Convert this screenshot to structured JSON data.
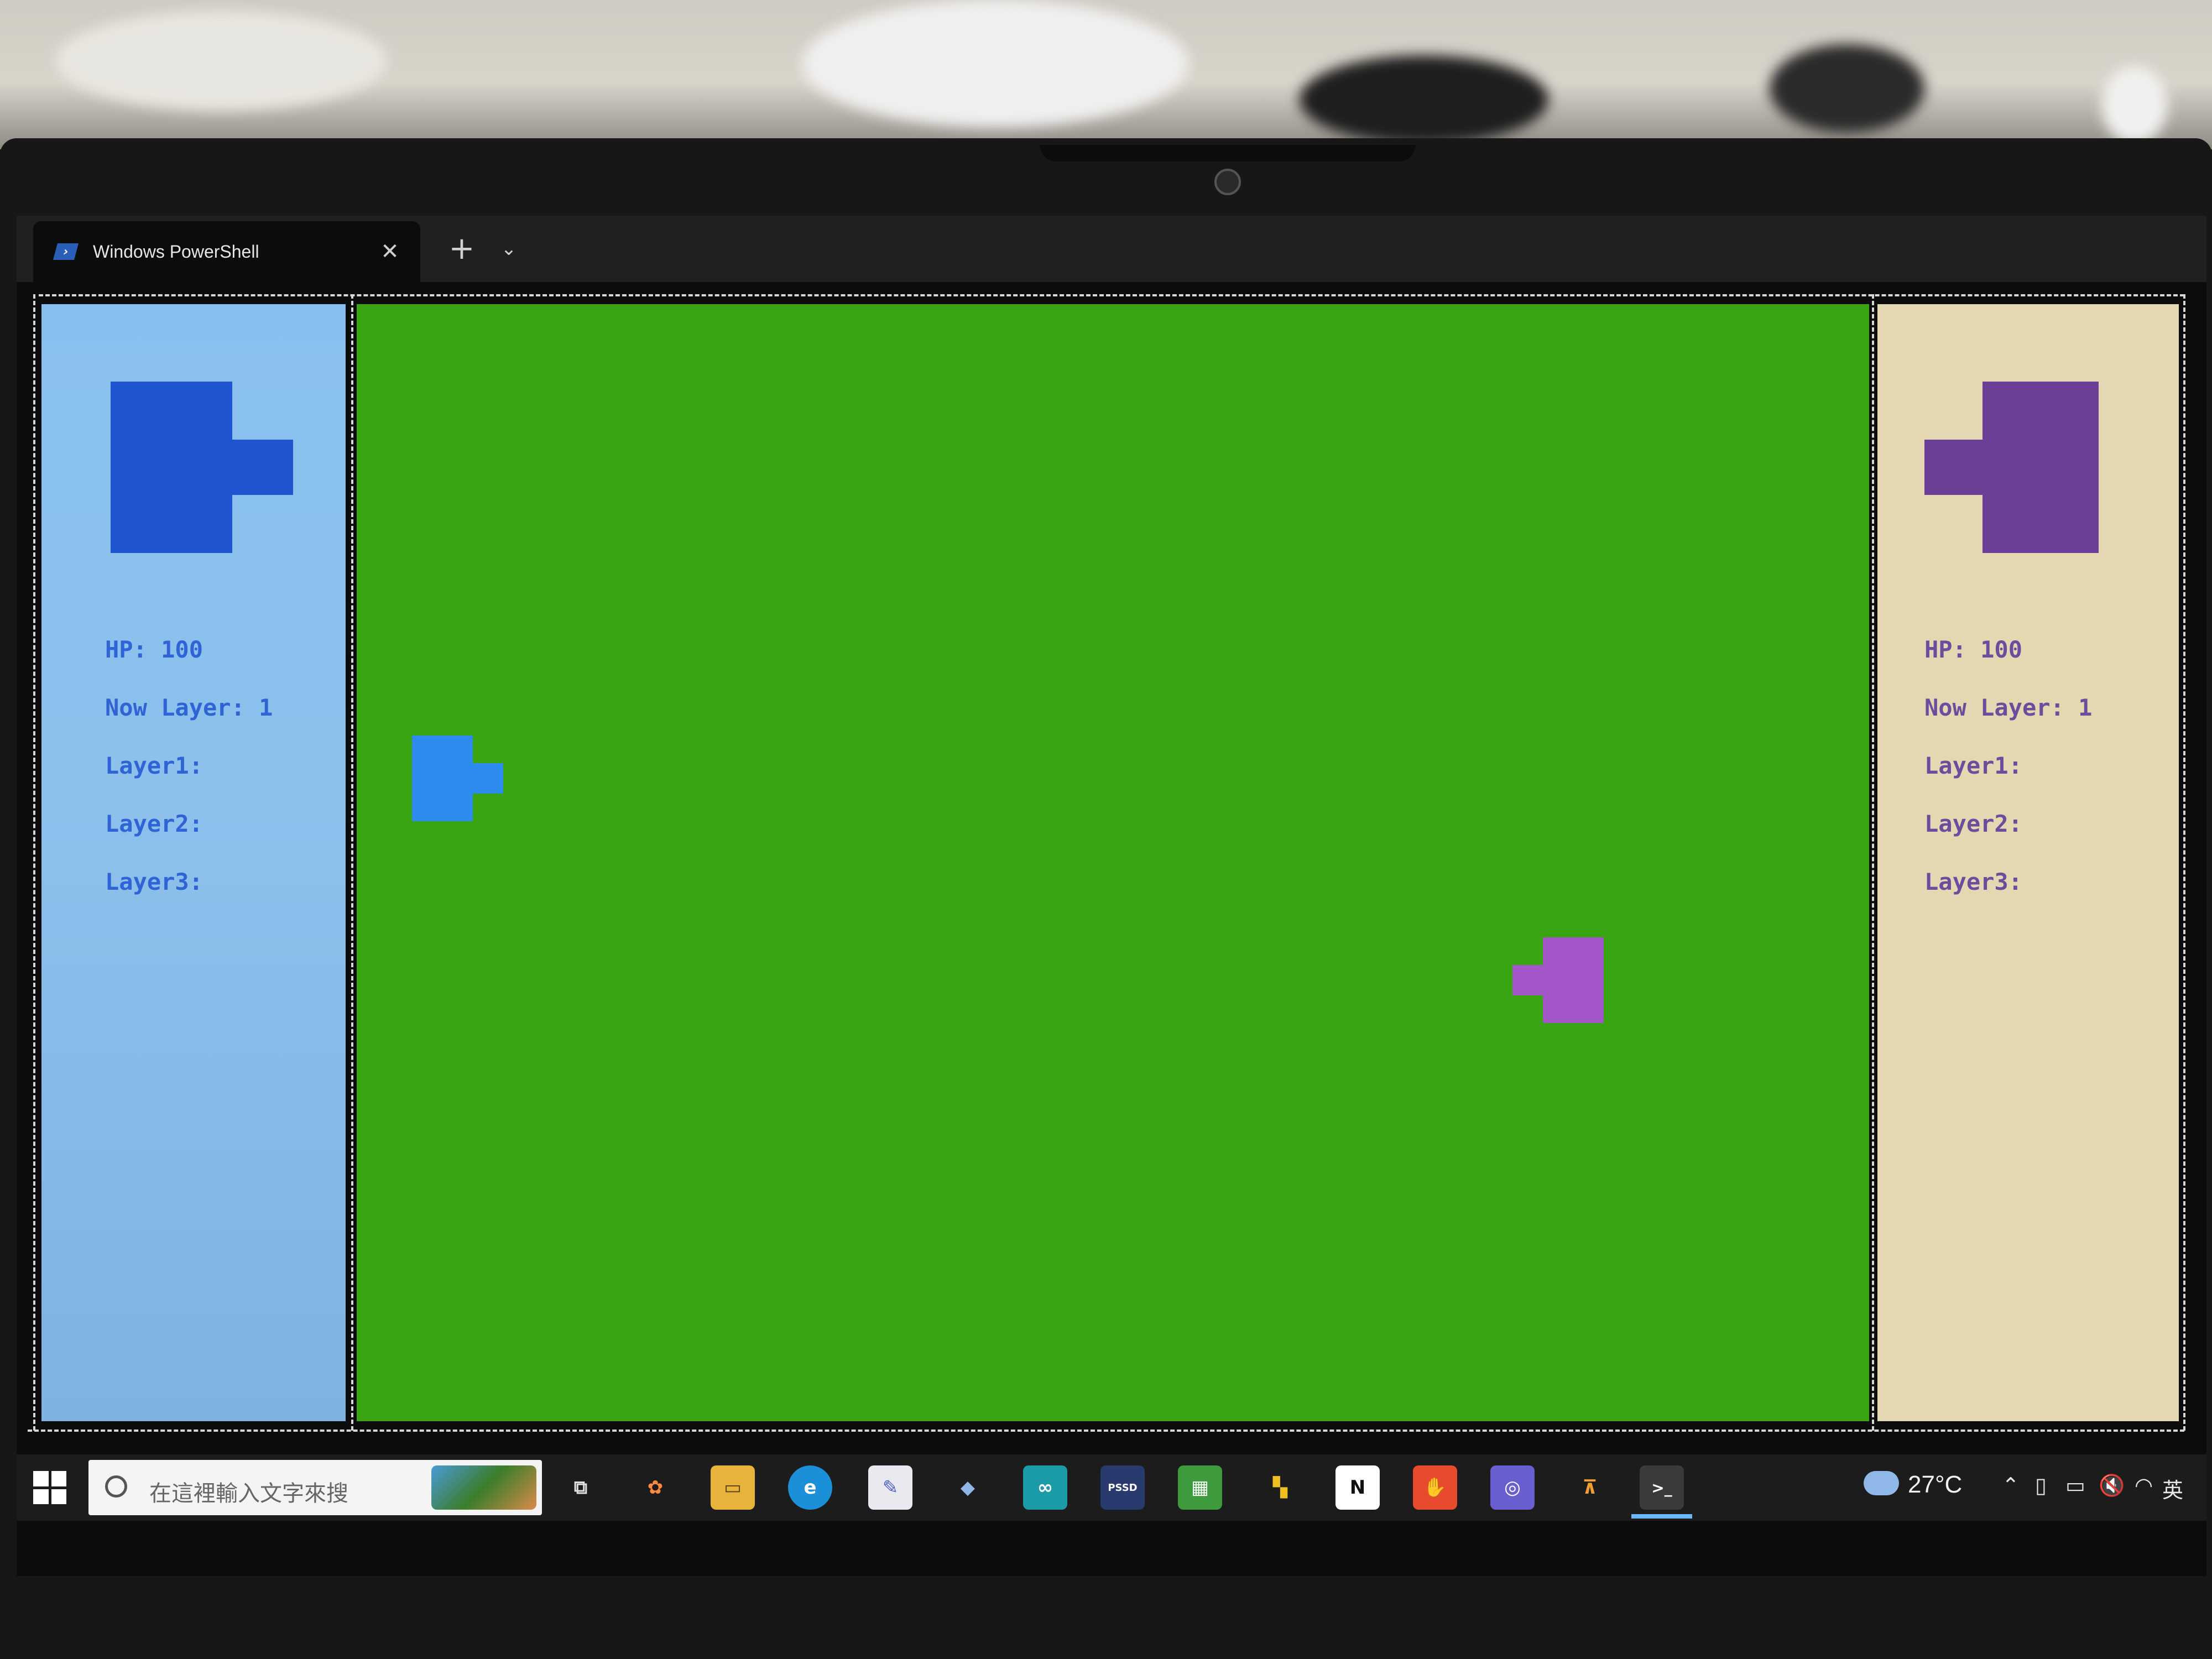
{
  "window": {
    "tab_title": "Windows PowerShell",
    "tab_icon_glyph": "›",
    "close_glyph": "✕",
    "new_tab_glyph": "+",
    "dropdown_glyph": "⌄"
  },
  "player_left": {
    "color": "#1f55d0",
    "text_color": "#2f63d6",
    "panel_color": "#8dc1ec",
    "hp_text": "HP: 100",
    "layer_text": "Now Layer: 1",
    "layers": [
      "Layer1:",
      "Layer2:",
      "Layer3:"
    ]
  },
  "player_right": {
    "color": "#6b3f96",
    "text_color": "#6a4d9c",
    "panel_color": "#e4d8b3",
    "hp_text": "HP: 100",
    "layer_text": "Now Layer: 1",
    "layers": [
      "Layer1:",
      "Layer2:",
      "Layer3:"
    ]
  },
  "game_field": {
    "background": "#3aa512",
    "tank_left_color": "#2e8cf0",
    "tank_right_color": "#a356c8"
  },
  "taskbar": {
    "search_placeholder": "在這裡輸入文字來搜",
    "weather_temp": "27°C",
    "language": "英",
    "apps": [
      {
        "name": "task-view-icon",
        "glyph": "⧉"
      },
      {
        "name": "copilot-icon",
        "glyph": "✿"
      },
      {
        "name": "file-explorer-icon",
        "glyph": "▭"
      },
      {
        "name": "edge-icon",
        "glyph": "e"
      },
      {
        "name": "paint-icon",
        "glyph": "✎"
      },
      {
        "name": "notepad-icon",
        "glyph": "◆"
      },
      {
        "name": "arduino-icon",
        "glyph": "∞"
      },
      {
        "name": "pssd-icon",
        "glyph": "PSSD"
      },
      {
        "name": "excel-like-icon",
        "glyph": "▦"
      },
      {
        "name": "store-icon",
        "glyph": "▚"
      },
      {
        "name": "notion-icon",
        "glyph": "N"
      },
      {
        "name": "handshake-app-icon",
        "glyph": "✋"
      },
      {
        "name": "camera-app-icon",
        "glyph": "◎"
      },
      {
        "name": "font-app-icon",
        "glyph": "⊼"
      },
      {
        "name": "terminal-icon",
        "glyph": ">_"
      }
    ]
  }
}
